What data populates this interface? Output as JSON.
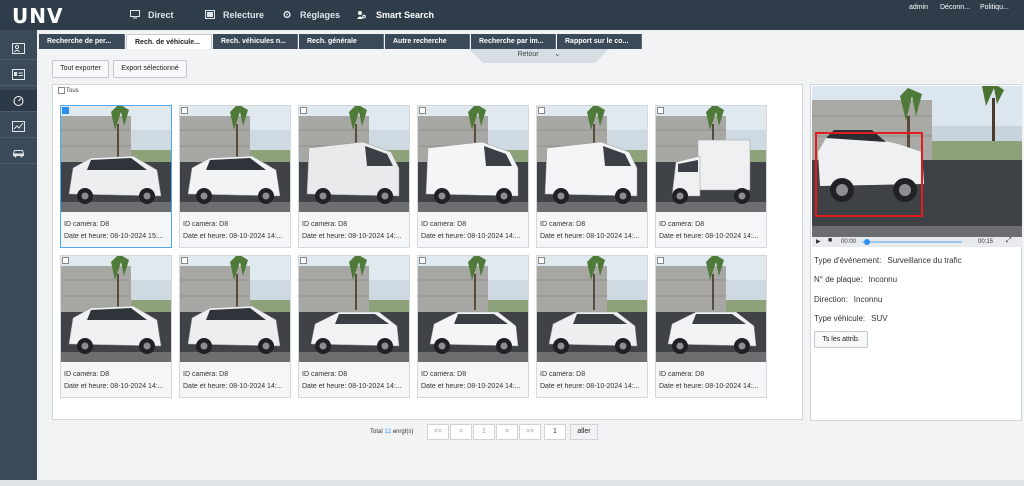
{
  "app": {
    "logo": "UNV"
  },
  "nav": [
    {
      "label": "Direct",
      "icon": "monitor-icon"
    },
    {
      "label": "Relecture",
      "icon": "film-icon"
    },
    {
      "label": "Réglages",
      "icon": "gear-icon"
    },
    {
      "label": "Smart Search",
      "icon": "person-search-icon",
      "active": true
    }
  ],
  "top_links": {
    "user": "admin",
    "logout": "Déconn...",
    "policy": "Politiqu..."
  },
  "tabs": [
    "Recherche de per...",
    "Rech. de véhicule...",
    "Rech. véhicules n...",
    "Rech. générale",
    "Autre recherche",
    "Recherche par im...",
    "Rapport sur le co..."
  ],
  "active_tab": 1,
  "retour": "Retour",
  "toolbar": {
    "export_all": "Tout exporter",
    "export_selected": "Export sélectionné"
  },
  "select_all": "Tous",
  "cards": [
    {
      "camera": "ID caméra: D8",
      "datetime": "Date et heure: 08-10-2024 15:...",
      "checked": true,
      "car": "#eceef0",
      "type": "suv"
    },
    {
      "camera": "ID caméra: D8",
      "datetime": "Date et heure: 08-10-2024 14:...",
      "car": "#f2f3f4",
      "type": "suv"
    },
    {
      "camera": "ID caméra: D8",
      "datetime": "Date et heure: 08-10-2024 14:...",
      "car": "#e9eaec",
      "type": "van"
    },
    {
      "camera": "ID caméra: D8",
      "datetime": "Date et heure: 08-10-2024 14:...",
      "car": "#f4f5f6",
      "type": "bigvan"
    },
    {
      "camera": "ID caméra: D8",
      "datetime": "Date et heure: 08-10-2024 14:...",
      "car": "#f3f4f5",
      "type": "van"
    },
    {
      "camera": "ID caméra: D8",
      "datetime": "Date et heure: 08-10-2024 14:...",
      "car": "#eef0f1",
      "type": "truck"
    },
    {
      "camera": "ID caméra: D8",
      "datetime": "Date et heure: 08-10-2024 14:...",
      "car": "#f0f1f3",
      "type": "suv"
    },
    {
      "camera": "ID caméra: D8",
      "datetime": "Date et heure: 08-10-2024 14:...",
      "car": "#eceef0",
      "type": "suv"
    },
    {
      "camera": "ID caméra: D8",
      "datetime": "Date et heure: 08-10-2024 14:...",
      "car": "#f1f2f4",
      "type": "car"
    },
    {
      "camera": "ID caméra: D8",
      "datetime": "Date et heure: 08-10-2024 14:...",
      "car": "#f4f5f6",
      "type": "car"
    },
    {
      "camera": "ID caméra: D8",
      "datetime": "Date et heure: 08-10-2024 14:...",
      "car": "#eeeff1",
      "type": "car"
    },
    {
      "camera": "ID caméra: D8",
      "datetime": "Date et heure: 08-10-2024 14:...",
      "car": "#f2f3f4",
      "type": "car"
    }
  ],
  "detail": {
    "time_start": "00:00",
    "time_end": "00:15",
    "event_label": "Type d'événement:",
    "event_value": "Surveillance du trafic",
    "plate_label": "N° de plaque:",
    "plate_value": "Inconnu",
    "direction_label": "Direction:",
    "direction_value": "Inconnu",
    "vehicle_label": "Type véhicule:",
    "vehicle_value": "SUV",
    "all_attrs": "Ts les attrib."
  },
  "pagination": {
    "total_prefix": "Total",
    "total_count": "12",
    "total_suffix": "enrgt(s)",
    "first": "<<",
    "prev": "<",
    "page": "1",
    "next": ">",
    "last": ">>",
    "goto_value": "1",
    "go": "aller"
  },
  "colors": {
    "topbar": "#2f3d4b",
    "sidebar": "#3b4a58",
    "accent": "#2a8ff0",
    "highlight": "#e31b1b"
  }
}
